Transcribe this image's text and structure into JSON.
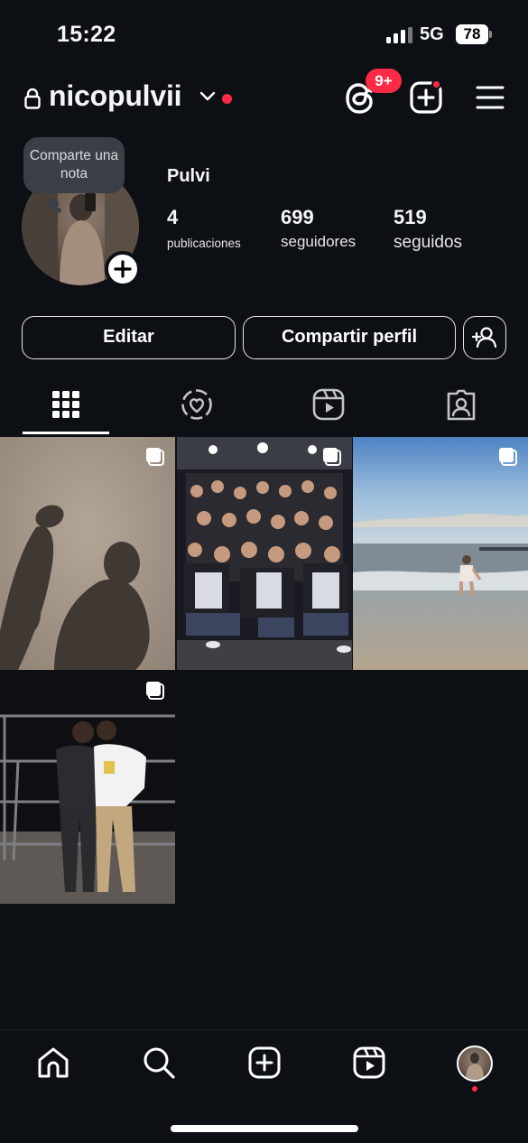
{
  "status_bar": {
    "time": "15:22",
    "network": "5G",
    "battery": "78"
  },
  "header": {
    "username": "nicopulvii",
    "notification_badge": "9+"
  },
  "profile": {
    "note_placeholder": "Comparte una nota",
    "display_name": "Pulvi",
    "stats": [
      {
        "value": "4",
        "label": "publicaciones"
      },
      {
        "value": "699",
        "label": "seguidores"
      },
      {
        "value": "519",
        "label": "seguidos"
      }
    ]
  },
  "actions": {
    "edit_label": "Editar",
    "share_label": "Compartir perfil"
  },
  "tabs": [
    {
      "icon": "grid-icon",
      "active": true
    },
    {
      "icon": "reposts-icon",
      "active": false
    },
    {
      "icon": "reels-icon",
      "active": false
    },
    {
      "icon": "tagged-icon",
      "active": false
    }
  ],
  "posts": [
    {
      "description": "shadows on sand",
      "multi": true
    },
    {
      "description": "group photo",
      "multi": true
    },
    {
      "description": "beach at sunset",
      "multi": true
    },
    {
      "description": "two friends at night",
      "multi": true
    }
  ],
  "bottom_nav": [
    "home-icon",
    "search-icon",
    "create-icon",
    "reels-icon",
    "profile-avatar"
  ],
  "colors": {
    "background": "#0c0f14",
    "accent_red": "#ff2a45",
    "text": "#f5f5f5"
  }
}
